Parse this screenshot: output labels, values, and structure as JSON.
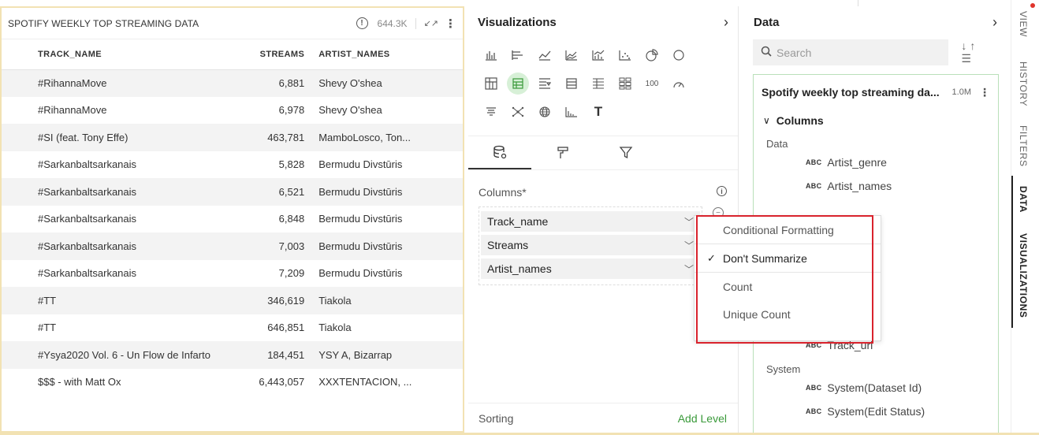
{
  "table": {
    "title": "SPOTIFY WEEKLY TOP STREAMING DATA",
    "count": "644.3K",
    "columns": [
      "TRACK_NAME",
      "STREAMS",
      "ARTIST_NAMES"
    ],
    "rows": [
      {
        "track": "#RihannaMove",
        "streams": "6,881",
        "artist": "Shevy O'shea"
      },
      {
        "track": "#RihannaMove",
        "streams": "6,978",
        "artist": "Shevy O'shea"
      },
      {
        "track": "#SI (feat. Tony Effe)",
        "streams": "463,781",
        "artist": "MamboLosco, Ton..."
      },
      {
        "track": "#Sarkanbaltsarkanais",
        "streams": "5,828",
        "artist": "Bermudu Divstūris"
      },
      {
        "track": "#Sarkanbaltsarkanais",
        "streams": "6,521",
        "artist": "Bermudu Divstūris"
      },
      {
        "track": "#Sarkanbaltsarkanais",
        "streams": "6,848",
        "artist": "Bermudu Divstūris"
      },
      {
        "track": "#Sarkanbaltsarkanais",
        "streams": "7,003",
        "artist": "Bermudu Divstūris"
      },
      {
        "track": "#Sarkanbaltsarkanais",
        "streams": "7,209",
        "artist": "Bermudu Divstūris"
      },
      {
        "track": "#TT",
        "streams": "346,619",
        "artist": "Tiakola"
      },
      {
        "track": "#TT",
        "streams": "646,851",
        "artist": "Tiakola"
      },
      {
        "track": "#Ysya2020 Vol. 6 - Un Flow de Infarto",
        "streams": "184,451",
        "artist": "YSY A, Bizarrap"
      },
      {
        "track": "$$$ - with Matt Ox",
        "streams": "6,443,057",
        "artist": "XXXTENTACION, ..."
      }
    ]
  },
  "visualizations": {
    "title": "Visualizations",
    "chart_icon_rows": [
      [
        "bar-chart-icon",
        "horizontal-bar-icon",
        "line-chart-icon",
        "area-chart-icon",
        "combo-chart-icon",
        "scatter-icon",
        "pie-chart-icon",
        "donut-icon"
      ],
      [
        "pivot-table-icon",
        "table-icon",
        "filter-table-icon",
        "grid-icon",
        "list-icon",
        "tiles-icon",
        "kpi-icon",
        "gauge-icon"
      ],
      [
        "funnel-icon",
        "network-icon",
        "globe-icon",
        "histogram-icon",
        "text-icon"
      ]
    ],
    "kpi_label": "100",
    "text_label": "T",
    "columns_label": "Columns*",
    "columns": [
      "Track_name",
      "Streams",
      "Artist_names"
    ],
    "sorting_label": "Sorting",
    "add_level": "Add Level"
  },
  "menu": {
    "items": [
      "Conditional Formatting",
      "Don't Summarize",
      "Count",
      "Unique Count"
    ],
    "checked": "Don't Summarize"
  },
  "data": {
    "title": "Data",
    "search_placeholder": "Search",
    "dataset_name": "Spotify weekly top streaming da...",
    "dataset_size": "1.0M",
    "columns_toggle": "Columns",
    "group_data": "Data",
    "fields_top": [
      "Artist_genre",
      "Artist_names"
    ],
    "fields_bottom": [
      "Track_url"
    ],
    "group_system": "System",
    "system_fields": [
      "System(Dataset Id)",
      "System(Edit Status)"
    ],
    "type_label": "ABC"
  },
  "rail": {
    "items": [
      "VIEW",
      "HISTORY",
      "FILTERS",
      "DATA",
      "VISUALIZATIONS"
    ]
  },
  "colors": {
    "accent_green": "#3a9a3a",
    "highlight_red": "#d9232d",
    "panel_border": "#f2e2b3"
  }
}
